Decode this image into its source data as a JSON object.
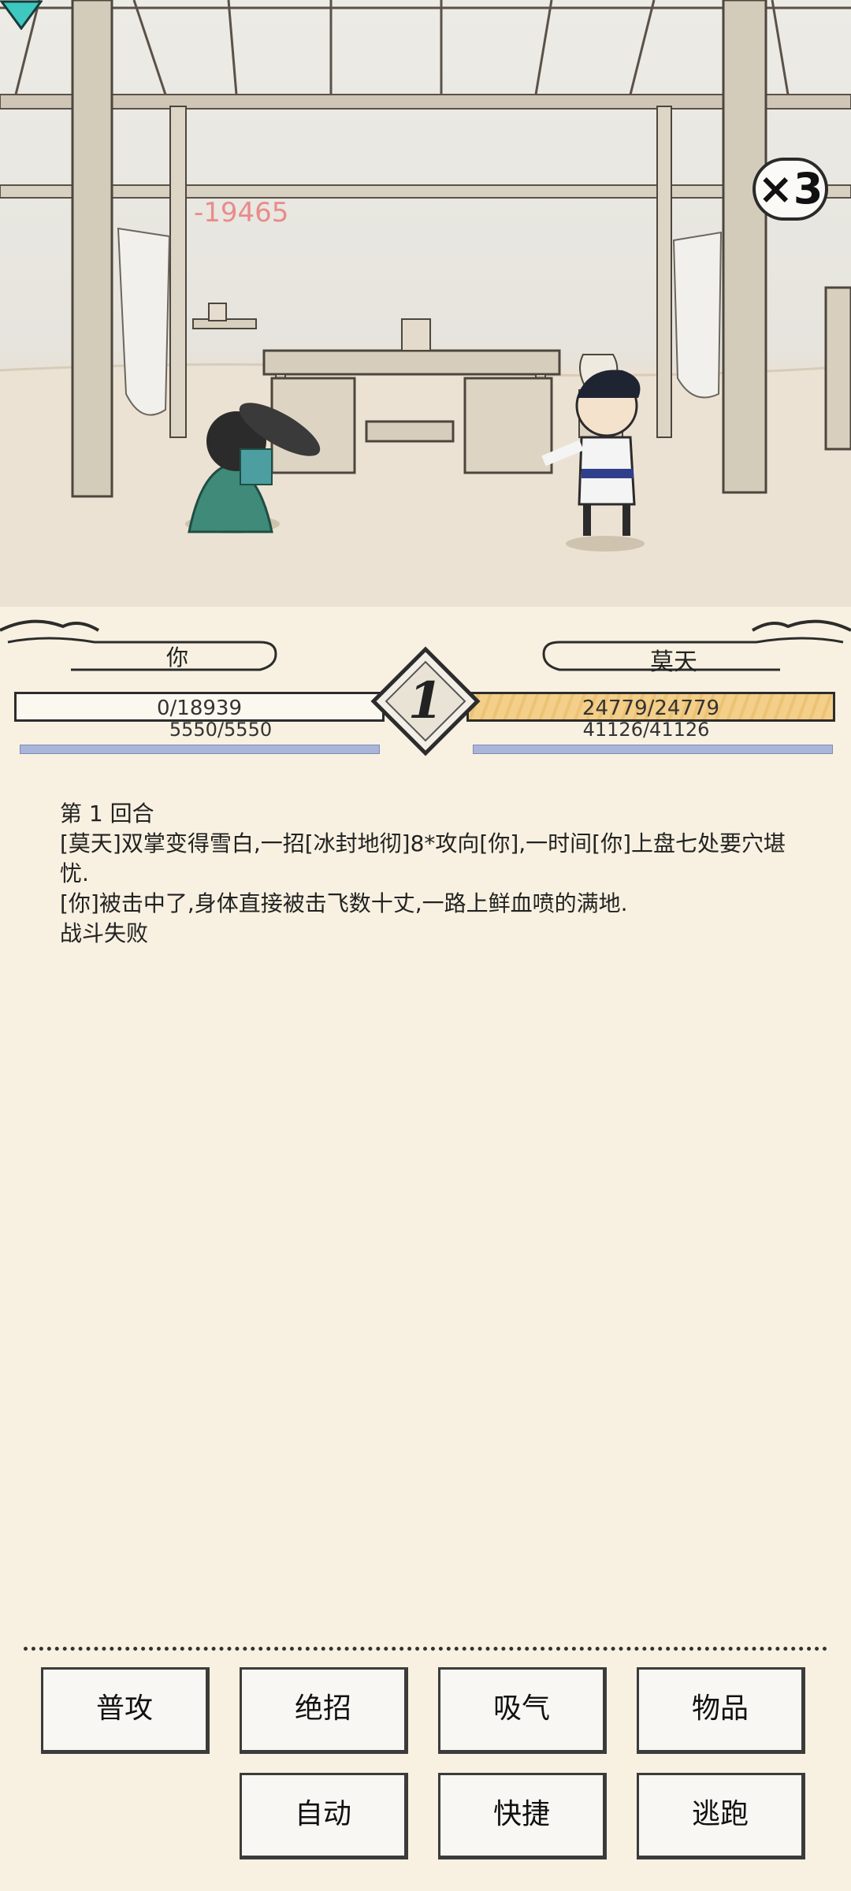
{
  "battle": {
    "speed_label": "×3",
    "damage_popup": "-19465"
  },
  "player": {
    "name": "你",
    "hp": "0/18939",
    "mp": "5550/5550",
    "hp_fraction": 0.0
  },
  "enemy": {
    "name": "莫天",
    "hp": "24779/24779",
    "mp": "41126/41126",
    "hp_fraction": 1.0
  },
  "round_number": "1",
  "log": [
    "第 1 回合",
    "[莫天]双掌变得雪白,一招[冰封地彻]8*攻向[你],一时间[你]上盘七处要穴堪忧.",
    "[你]被击中了,身体直接被击飞数十丈,一路上鲜血喷的满地.",
    "战斗失败"
  ],
  "actions": {
    "attack": "普攻",
    "ultimate": "绝招",
    "breathe": "吸气",
    "items": "物品",
    "auto": "自动",
    "shortcut": "快捷",
    "flee": "逃跑"
  }
}
